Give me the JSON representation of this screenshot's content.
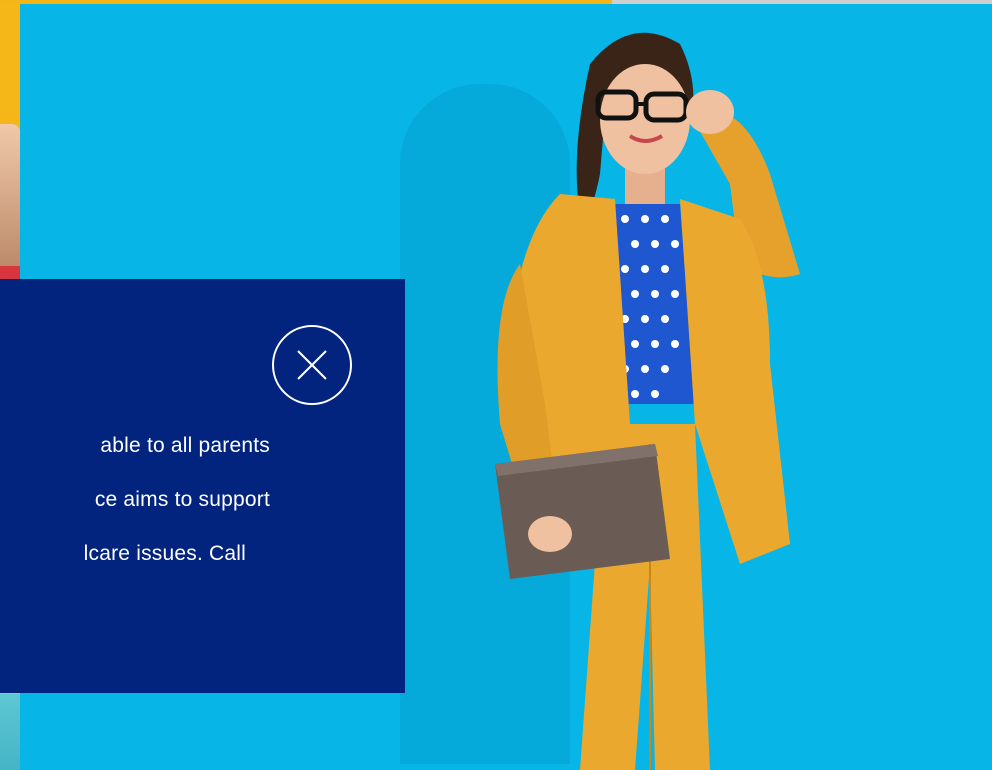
{
  "hero": {
    "background_color": "#07b5e6",
    "image_subject": "woman-in-yellow-suit-with-laptop"
  },
  "modal": {
    "background_color": "#02247f",
    "body_lines": [
      "able to all parents",
      "ce aims to support",
      "lcare issues. Call"
    ],
    "close_icon": "close-icon"
  },
  "accent_colors": {
    "yellow": "#f6b516",
    "red": "#d9353e"
  }
}
